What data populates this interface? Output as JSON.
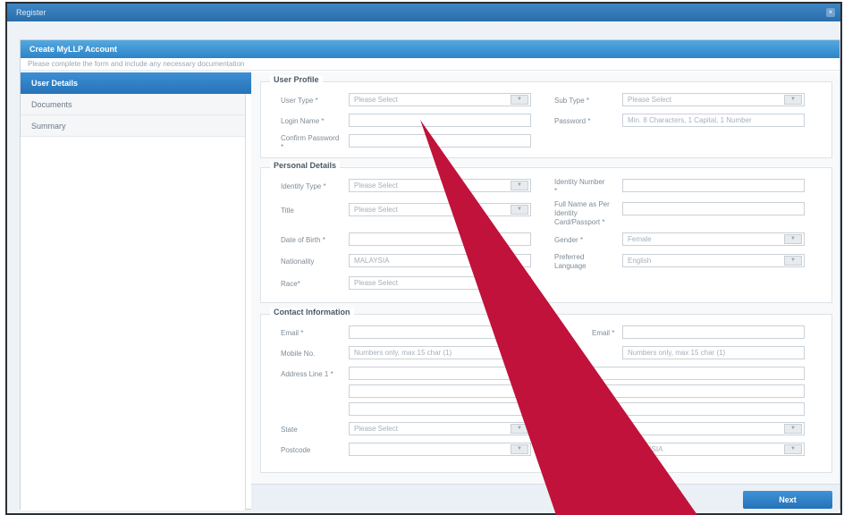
{
  "window": {
    "title": "Register",
    "close_glyph": "×"
  },
  "card": {
    "title": "Create MyLLP Account",
    "subtitle": "Please complete the form and include any necessary documentation"
  },
  "sidebar": {
    "items": [
      {
        "label": "User Details",
        "active": true
      },
      {
        "label": "Documents",
        "active": false
      },
      {
        "label": "Summary",
        "active": false
      }
    ]
  },
  "user_profile": {
    "title": "User Profile",
    "user_type": {
      "label": "User Type *",
      "value": "Please Select"
    },
    "sub_type": {
      "label": "Sub Type *",
      "value": "Please Select"
    },
    "login_name": {
      "label": "Login Name *",
      "value": ""
    },
    "password": {
      "label": "Password *",
      "placeholder": "Min. 8 Characters, 1 Capital, 1 Number"
    },
    "confirm_password": {
      "label": "Confirm Password *",
      "value": ""
    }
  },
  "personal_details": {
    "title": "Personal Details",
    "identity_type": {
      "label": "Identity Type *",
      "value": "Please Select"
    },
    "identity_number": {
      "label": "Identity Number *",
      "value": ""
    },
    "title_field": {
      "label": "Title",
      "value": "Please Select"
    },
    "full_name": {
      "label": "Full Name as Per Identity Card/Passport *",
      "value": ""
    },
    "date_of_birth": {
      "label": "Date of Birth *",
      "value": ""
    },
    "gender": {
      "label": "Gender *",
      "value": "Female"
    },
    "nationality": {
      "label": "Nationality",
      "value": "MALAYSIA"
    },
    "preferred_language": {
      "label": "Preferred Language",
      "value": "English"
    },
    "race": {
      "label": "Race*",
      "value": "Please Select"
    }
  },
  "contact_information": {
    "title": "Contact Information",
    "email": {
      "label": "Email *",
      "value": ""
    },
    "confirm_email": {
      "label": "Email *",
      "value": ""
    },
    "mobile_no": {
      "label": "Mobile No.",
      "placeholder": "Numbers only, max 15 char (1)"
    },
    "phone_no": {
      "placeholder": "Numbers only, max 15 char (1)"
    },
    "address_line": {
      "label": "Address Line 1 *",
      "value": ""
    },
    "state": {
      "label": "State",
      "value": "Please Select"
    },
    "postcode": {
      "label": "Postcode",
      "value": ""
    },
    "country": {
      "value": "MALAYSIA"
    }
  },
  "footer": {
    "next_label": "Next"
  },
  "overlay": {
    "arrow_color": "#c0123a",
    "type": "pointer-arrow"
  },
  "colors": {
    "accent": "#2d84c8",
    "window_border": "#2b2f36",
    "panel": "#f7f9fa"
  }
}
